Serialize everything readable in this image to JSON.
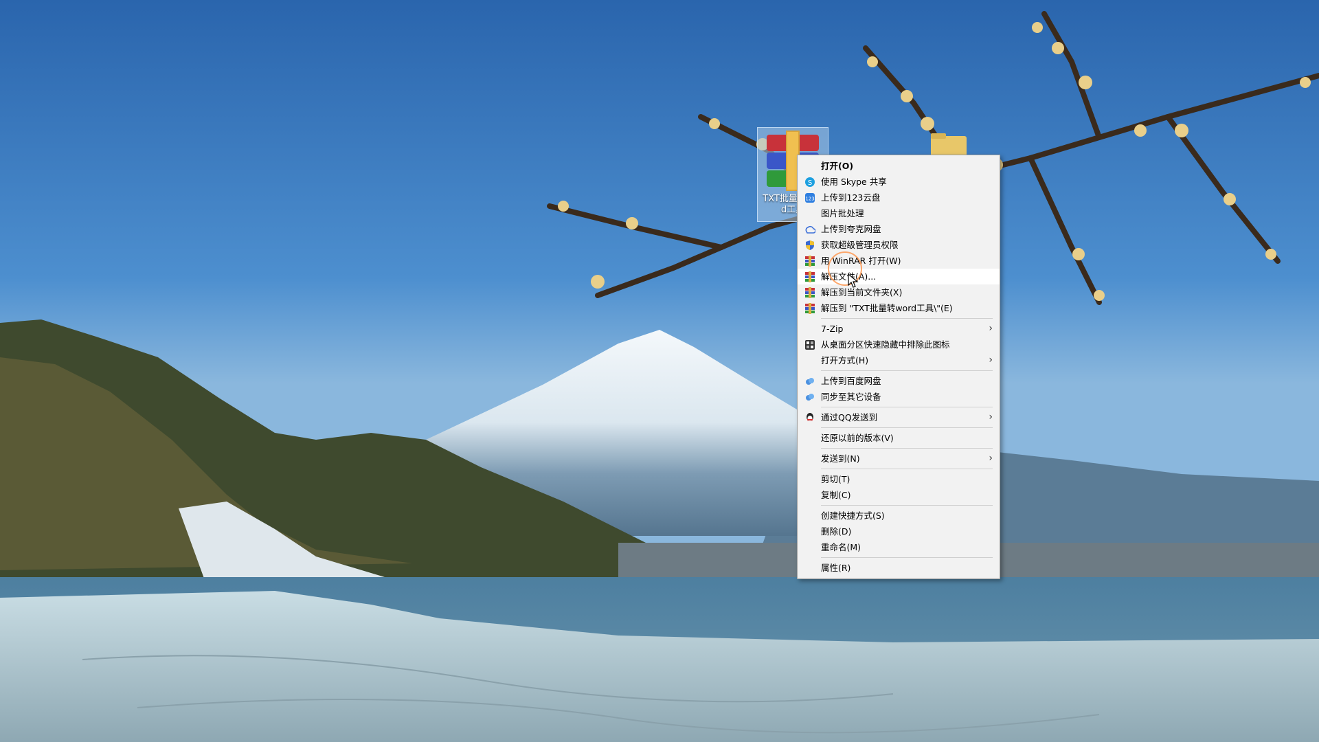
{
  "desktop": {
    "icons": [
      {
        "label": "TXT批量转word工具",
        "selected": true
      },
      {
        "label": "",
        "selected": false
      }
    ]
  },
  "context_menu": {
    "items": [
      {
        "label": "打开(O)",
        "icon": "none",
        "bold": true
      },
      {
        "label": "使用 Skype 共享",
        "icon": "skype-icon"
      },
      {
        "label": "上传到123云盘",
        "icon": "123pan-icon"
      },
      {
        "label": "图片批处理",
        "icon": "none"
      },
      {
        "label": "上传到夸克网盘",
        "icon": "quark-cloud-icon"
      },
      {
        "label": "获取超级管理员权限",
        "icon": "shield-icon"
      },
      {
        "label": "用 WinRAR 打开(W)",
        "icon": "winrar-icon"
      },
      {
        "label": "解压文件(A)...",
        "icon": "winrar-icon",
        "hover": true
      },
      {
        "label": "解压到当前文件夹(X)",
        "icon": "winrar-icon"
      },
      {
        "label": "解压到 \"TXT批量转word工具\\\"(E)",
        "icon": "winrar-icon"
      },
      {
        "label": "7-Zip",
        "icon": "none",
        "submenu": true
      },
      {
        "label": "从桌面分区快速隐藏中排除此图标",
        "icon": "fences-icon"
      },
      {
        "label": "打开方式(H)",
        "icon": "none",
        "submenu": true
      },
      {
        "label": "上传到百度网盘",
        "icon": "baidu-cloud-icon"
      },
      {
        "label": "同步至其它设备",
        "icon": "baidu-cloud-icon"
      },
      {
        "label": "通过QQ发送到",
        "icon": "qq-icon",
        "submenu": true
      },
      {
        "label": "还原以前的版本(V)",
        "icon": "none"
      },
      {
        "label": "发送到(N)",
        "icon": "none",
        "submenu": true
      },
      {
        "label": "剪切(T)",
        "icon": "none"
      },
      {
        "label": "复制(C)",
        "icon": "none"
      },
      {
        "label": "创建快捷方式(S)",
        "icon": "none"
      },
      {
        "label": "删除(D)",
        "icon": "none"
      },
      {
        "label": "重命名(M)",
        "icon": "none"
      },
      {
        "label": "属性(R)",
        "icon": "none"
      }
    ],
    "submenu_arrow": "›"
  },
  "colors": {
    "menu_bg": "#f2f2f2",
    "menu_hover": "#ffffff",
    "separator": "#cfcfcf",
    "click_ring": "#ff8c3c"
  }
}
